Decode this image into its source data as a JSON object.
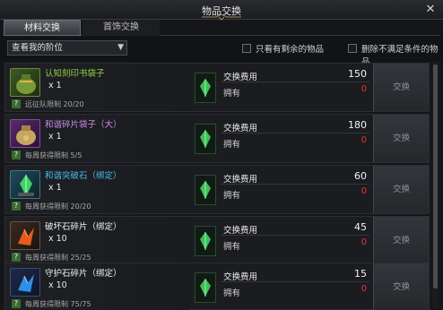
{
  "window": {
    "title": "物品交换"
  },
  "tabs": [
    {
      "label": "材料交换",
      "active": true
    },
    {
      "label": "首饰交换",
      "active": false
    }
  ],
  "filter": {
    "select_value": "查看我的阶位",
    "only_remaining_label": "只看有剩余的物品",
    "hide_unmet_label": "删除不满足条件的物品"
  },
  "colors": {
    "red": "#e23434",
    "green": "#8fd34a",
    "purple": "#c98ae6",
    "blue": "#4fb8e8",
    "white": "#f0f0f0"
  },
  "items": [
    {
      "name": "认知刻印书袋子",
      "name_color": "#8fd34a",
      "qty": "x 1",
      "limit": "远征队限制 20/20",
      "cost_label": "交换费用",
      "own_label": "拥有",
      "cost": "150",
      "own": "0",
      "button": "交换",
      "icon": "green-pouch-icon"
    },
    {
      "name": "和谐碎片袋子（大）",
      "name_color": "#c98ae6",
      "qty": "x 1",
      "limit": "每周获得限制 5/5",
      "cost_label": "交换费用",
      "own_label": "拥有",
      "cost": "180",
      "own": "0",
      "button": "交换",
      "icon": "purple-pouch-icon"
    },
    {
      "name": "和谐突破石（绑定）",
      "name_color": "#4fb8e8",
      "qty": "x 1",
      "limit": "每周获得限制 20/20",
      "cost_label": "交换费用",
      "own_label": "拥有",
      "cost": "60",
      "own": "0",
      "button": "交换",
      "icon": "green-crystal-icon"
    },
    {
      "name": "破坏石碎片（绑定）",
      "name_color": "#f0f0f0",
      "qty": "x 10",
      "limit": "每周获得限制 25/25",
      "cost_label": "交换费用",
      "own_label": "拥有",
      "cost": "45",
      "own": "0",
      "button": "交换",
      "icon": "red-shard-icon"
    },
    {
      "name": "守护石碎片（绑定）",
      "name_color": "#f0f0f0",
      "qty": "x 10",
      "limit": "每周获得限制 75/75",
      "cost_label": "交换费用",
      "own_label": "拥有",
      "cost": "15",
      "own": "0",
      "button": "交换",
      "icon": "blue-shard-icon"
    }
  ]
}
